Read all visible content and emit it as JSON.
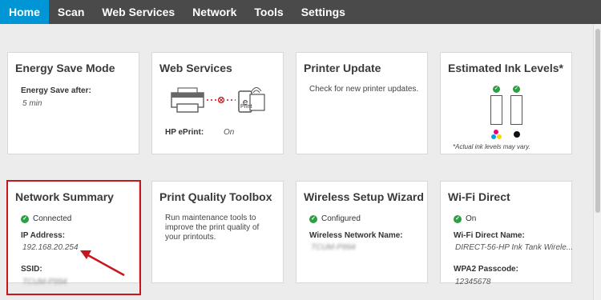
{
  "nav": {
    "tabs": [
      {
        "label": "Home",
        "active": true
      },
      {
        "label": "Scan"
      },
      {
        "label": "Web Services"
      },
      {
        "label": "Network"
      },
      {
        "label": "Tools"
      },
      {
        "label": "Settings"
      }
    ]
  },
  "colors": {
    "topbar": "#4a4a4a",
    "active_tab": "#0096d6",
    "highlight": "#c8161d",
    "ok": "#2e9e44",
    "background": "#ececec"
  },
  "cards": {
    "energy": {
      "title": "Energy Save Mode",
      "label": "Energy Save after:",
      "value": "5 min"
    },
    "web_services": {
      "title": "Web Services",
      "eprint_label": "HP ePrint:",
      "eprint_value": "On",
      "eprint_icon_text": "Print"
    },
    "printer_update": {
      "title": "Printer Update",
      "text": "Check for new printer updates."
    },
    "ink": {
      "title": "Estimated Ink Levels*",
      "note": "*Actual ink levels may vary.",
      "cartridges": [
        "tri-color",
        "black"
      ]
    },
    "network": {
      "title": "Network Summary",
      "status": "Connected",
      "ip_label": "IP Address:",
      "ip_value": "192.168.20.254",
      "ssid_label": "SSID:",
      "ssid_value": "TCUM-P994"
    },
    "print_quality": {
      "title": "Print Quality Toolbox",
      "text": "Run maintenance tools to improve the print quality of your printouts."
    },
    "wireless": {
      "title": "Wireless Setup Wizard",
      "status": "Configured",
      "network_label": "Wireless Network Name:",
      "network_value": "TCUM-P994"
    },
    "wifi_direct": {
      "title": "Wi-Fi Direct",
      "status": "On",
      "name_label": "Wi-Fi Direct Name:",
      "name_value": "DIRECT-56-HP Ink Tank Wirele...",
      "pass_label": "WPA2 Passcode:",
      "pass_value": "12345678"
    }
  },
  "icons": {
    "status": "check-circle-icon",
    "printer": "printer-icon",
    "eprint": "eprint-icon",
    "ink": "ink-cartridge-icon",
    "annotation": "red-arrow-icon"
  }
}
